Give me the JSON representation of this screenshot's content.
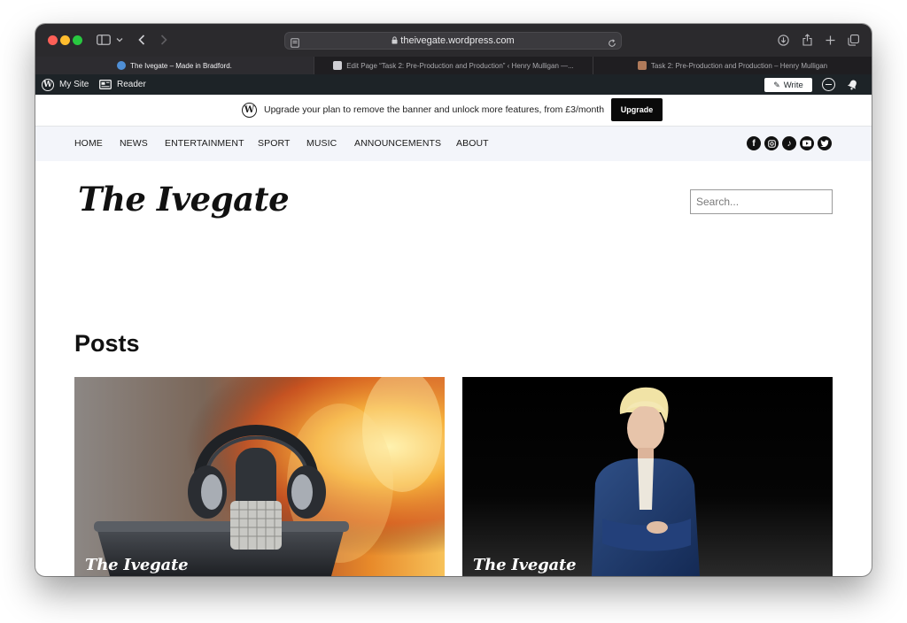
{
  "browser": {
    "url": "theivegate.wordpress.com",
    "tabs": [
      {
        "title": "The Ivegate – Made in Bradford.",
        "active": true
      },
      {
        "title": "Edit Page “Task 2: Pre-Production and Production” ‹ Henry Mulligan —...",
        "active": false
      },
      {
        "title": "Task 2: Pre-Production and Production – Henry Mulligan",
        "active": false
      }
    ]
  },
  "admin_bar": {
    "my_site": "My Site",
    "reader": "Reader",
    "write": "Write"
  },
  "banner": {
    "text": "Upgrade your plan to remove the banner and unlock more features, from £3/month",
    "button": "Upgrade"
  },
  "nav": {
    "items": [
      "HOME",
      "NEWS",
      "ENTERTAINMENT",
      "SPORT",
      "MUSIC",
      "ANNOUNCEMENTS",
      "ABOUT"
    ],
    "social": [
      "facebook-icon",
      "instagram-icon",
      "tiktok-icon",
      "youtube-icon",
      "twitter-icon"
    ]
  },
  "site": {
    "logo": "The Ivegate",
    "search_placeholder": "Search..."
  },
  "posts": {
    "heading": "Posts",
    "cards": [
      {
        "image": "microphone-headphones-fire",
        "logo": "The Ivegate"
      },
      {
        "image": "person-in-blue-suit",
        "logo": "The Ivegate"
      }
    ]
  },
  "colors": {
    "titlebar": "#2b2a2d",
    "adminbar": "#1d2327",
    "nav_bg": "#f3f5fa",
    "upgrade_button": "#0a0a0a"
  }
}
